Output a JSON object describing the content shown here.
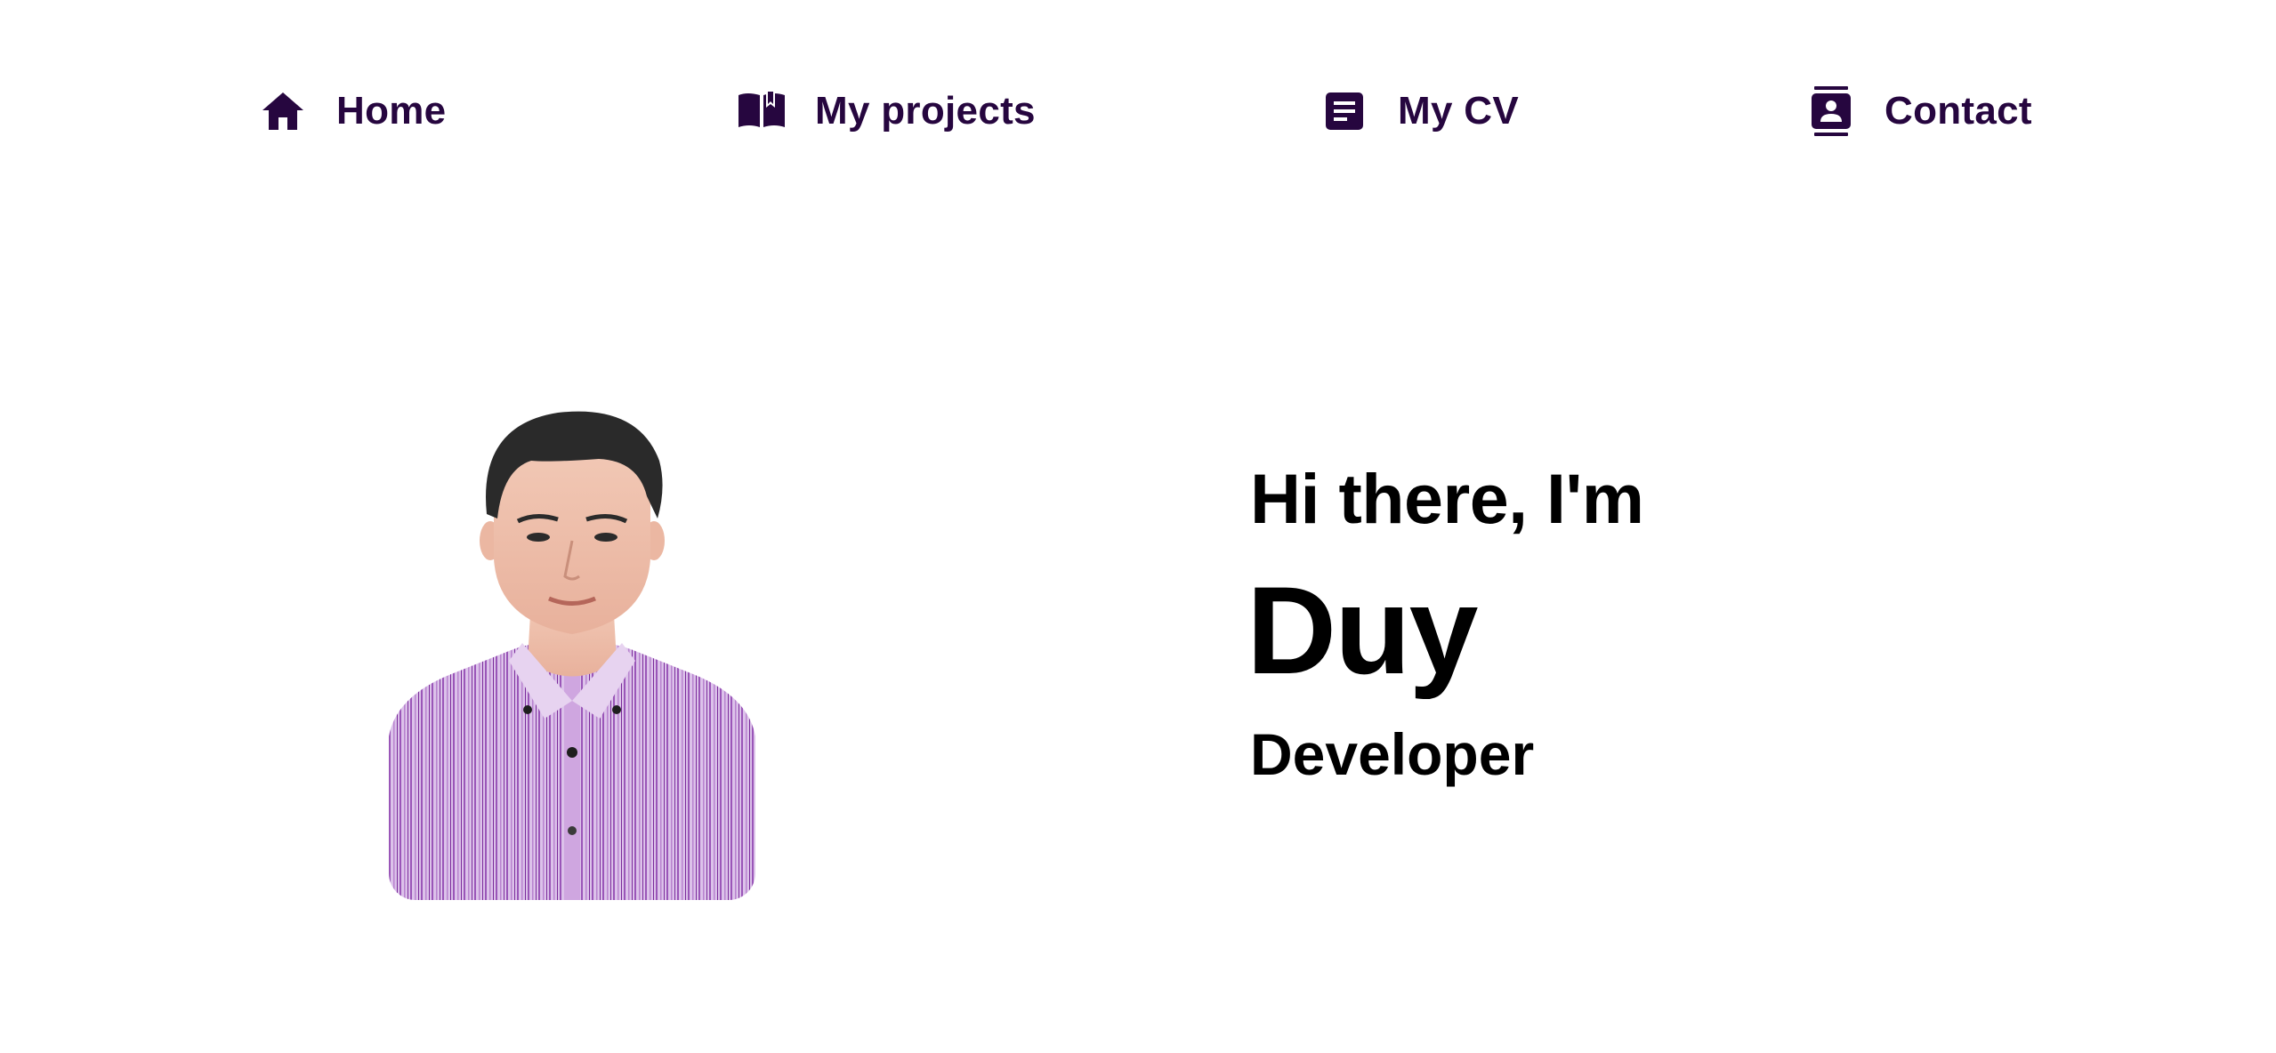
{
  "theme": {
    "nav_color": "#26063f",
    "text_color": "#000000",
    "background": "#ffffff",
    "shirt_color": "#c9a3dc"
  },
  "nav": {
    "items": [
      {
        "label": "Home",
        "icon": "home-icon"
      },
      {
        "label": "My projects",
        "icon": "open-book-icon"
      },
      {
        "label": "My CV",
        "icon": "document-icon"
      },
      {
        "label": "Contact",
        "icon": "contact-card-icon"
      }
    ]
  },
  "hero": {
    "greeting": "Hi there, I'm",
    "name": "Duy",
    "role": "Developer",
    "photo_icon": "profile-photo"
  }
}
